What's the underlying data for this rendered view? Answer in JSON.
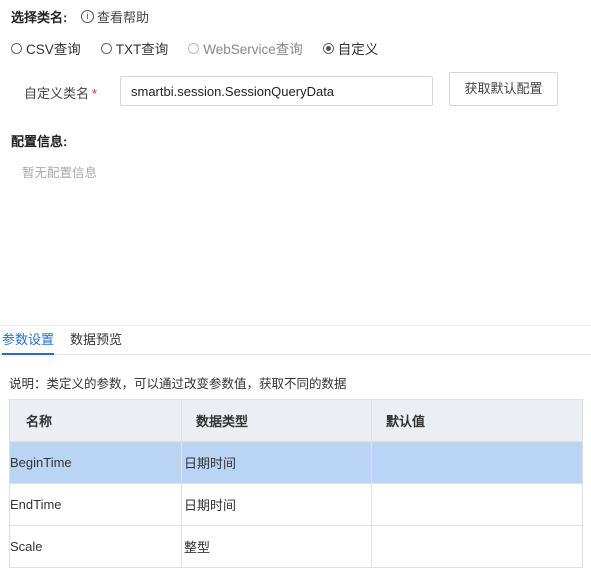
{
  "header": {
    "select_class_label": "选择类名:",
    "help_icon": "info-circle-icon",
    "help_label": "查看帮助"
  },
  "query_types": {
    "options": [
      {
        "label": "CSV查询",
        "checked": false,
        "disabled": false
      },
      {
        "label": "TXT查询",
        "checked": false,
        "disabled": false
      },
      {
        "label": "WebService查询",
        "checked": false,
        "disabled": true
      },
      {
        "label": "自定义",
        "checked": true,
        "disabled": false
      }
    ]
  },
  "custom_class": {
    "label": "自定义类名",
    "required_mark": "*",
    "value": "smartbi.session.SessionQueryData",
    "fetch_button": "获取默认配置"
  },
  "config": {
    "title": "配置信息:",
    "empty_text": "暂无配置信息"
  },
  "tabs": [
    {
      "label": "参数设置",
      "active": true
    },
    {
      "label": "数据预览",
      "active": false
    }
  ],
  "params": {
    "description": "说明：类定义的参数，可以通过改变参数值，获取不同的数据",
    "columns": [
      "名称",
      "数据类型",
      "默认值"
    ],
    "rows": [
      {
        "name": "BeginTime",
        "type": "日期时间",
        "default": "",
        "selected": true
      },
      {
        "name": "EndTime",
        "type": "日期时间",
        "default": "",
        "selected": false
      },
      {
        "name": "Scale",
        "type": "整型",
        "default": "",
        "selected": false
      }
    ]
  },
  "colors": {
    "accent": "#1e6fd9",
    "selected_row": "#bad5f3",
    "header_bg": "#ebeef3",
    "required": "#ee2233"
  }
}
